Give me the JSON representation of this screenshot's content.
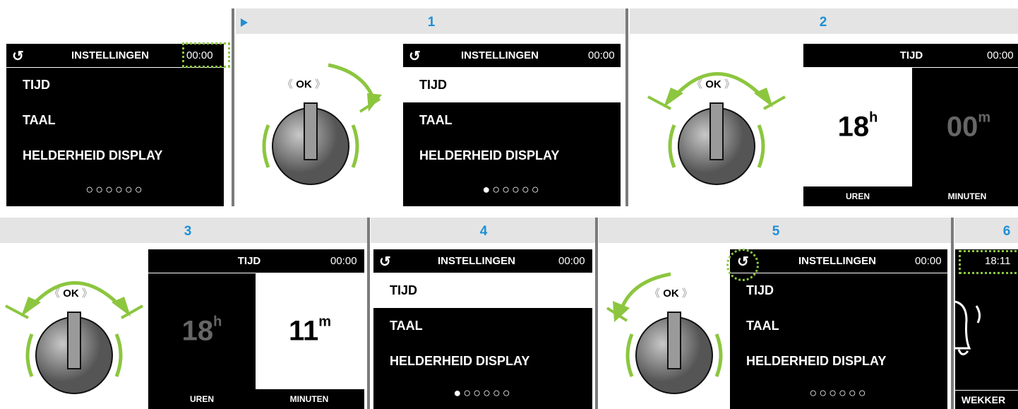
{
  "steps": {
    "s1": "1",
    "s2": "2",
    "s3": "3",
    "s4": "4",
    "s5": "5",
    "s6": "6"
  },
  "knob": {
    "label": "OK"
  },
  "screens": {
    "start": {
      "back_icon": "↺",
      "title": "INSTELLINGEN",
      "clock": "00:00",
      "items": [
        "TIJD",
        "TAAL",
        "HELDERHEID DISPLAY"
      ],
      "dots": "○○○○○○"
    },
    "step1": {
      "back_icon": "↺",
      "title": "INSTELLINGEN",
      "clock": "00:00",
      "items": [
        "TIJD",
        "TAAL",
        "HELDERHEID DISPLAY"
      ],
      "dots": "●○○○○○"
    },
    "step2": {
      "title": "TIJD",
      "clock": "00:00",
      "hours": "18",
      "hours_unit": "h",
      "minutes": "00",
      "minutes_unit": "m",
      "hours_label": "UREN",
      "minutes_label": "MINUTEN"
    },
    "step3": {
      "title": "TIJD",
      "clock": "00:00",
      "hours": "18",
      "hours_unit": "h",
      "minutes": "11",
      "minutes_unit": "m",
      "hours_label": "UREN",
      "minutes_label": "MINUTEN"
    },
    "step4": {
      "back_icon": "↺",
      "title": "INSTELLINGEN",
      "clock": "00:00",
      "items": [
        "TIJD",
        "TAAL",
        "HELDERHEID DISPLAY"
      ],
      "dots": "●○○○○○"
    },
    "step5": {
      "back_icon": "↺",
      "title": "INSTELLINGEN",
      "clock": "00:00",
      "items": [
        "TIJD",
        "TAAL",
        "HELDERHEID DISPLAY"
      ],
      "dots": "○○○○○○"
    },
    "step6": {
      "clock": "18:11",
      "label": "WEKKER",
      "icon": "bell-icon"
    }
  },
  "colors": {
    "accent_green": "#8cc63f",
    "step_blue": "#1e8fd6",
    "header_gray": "#e4e4e4"
  }
}
